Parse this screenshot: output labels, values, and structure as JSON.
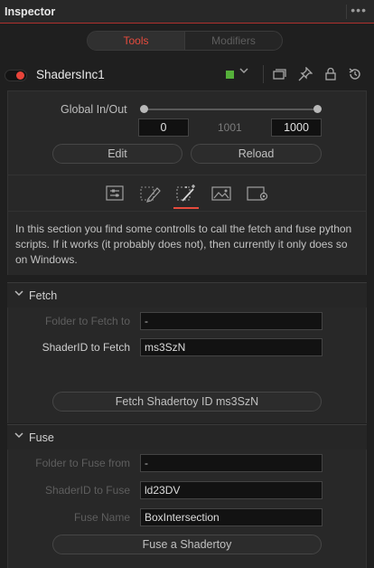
{
  "header": {
    "title": "Inspector",
    "menu_glyph": "•••"
  },
  "tabs": [
    {
      "label": "Tools",
      "active": true
    },
    {
      "label": "Modifiers",
      "active": false
    }
  ],
  "node": {
    "name": "ShadersInc1",
    "color": "#55b03a",
    "icons": [
      "chevron-down-icon",
      "versions-icon",
      "pin-icon",
      "lock-icon",
      "reset-icon"
    ]
  },
  "global_inout": {
    "label": "Global In/Out",
    "start": "0",
    "middle": "1001",
    "end": "1000"
  },
  "buttons": {
    "edit": "Edit",
    "reload": "Reload"
  },
  "icon_tabs": [
    {
      "name": "controls-tab",
      "active": false
    },
    {
      "name": "pencil-tab",
      "active": false
    },
    {
      "name": "magic-wand-tab",
      "active": true
    },
    {
      "name": "image-tab",
      "active": false
    },
    {
      "name": "settings-tab",
      "active": false
    }
  ],
  "description": "In this section you find some controlls to call the fetch and fuse python scripts. If it works (it probably does not), then currently it only does so on Windows.",
  "fetch": {
    "title": "Fetch",
    "folder_label": "Folder to Fetch to",
    "folder_value": "-",
    "shader_label": "ShaderID to Fetch",
    "shader_value": "ms3SzN",
    "button": "Fetch Shadertoy ID ms3SzN"
  },
  "fuse": {
    "title": "Fuse",
    "folder_label": "Folder to Fuse from",
    "folder_value": "-",
    "shader_label": "ShaderID to Fuse",
    "shader_value": "ld23DV",
    "name_label": "Fuse Name",
    "name_value": "BoxIntersection",
    "button": "Fuse a Shadertoy"
  },
  "colors": {
    "accent": "#e64b3d",
    "background": "#1f1f1f",
    "panel": "#282828"
  }
}
